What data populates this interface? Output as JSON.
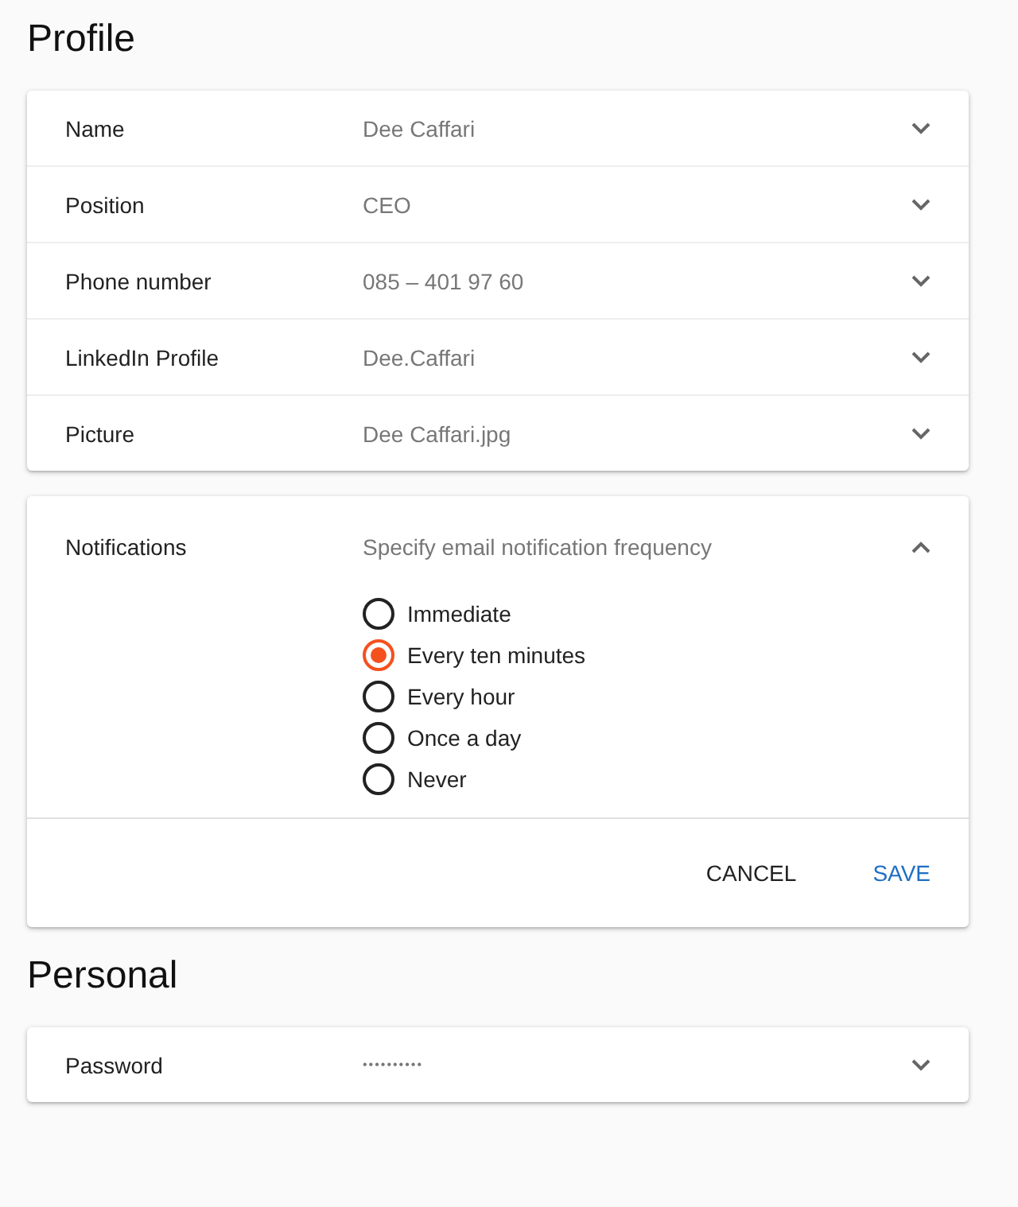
{
  "sections": [
    {
      "title": "Profile",
      "panels": [
        {
          "label": "Name",
          "value": "Dee Caffari",
          "expanded": false
        },
        {
          "label": "Position",
          "value": "CEO",
          "expanded": false
        },
        {
          "label": "Phone number",
          "value": "085 – 401 97 60",
          "expanded": false
        },
        {
          "label": "LinkedIn Profile",
          "value": "Dee.Caffari",
          "expanded": false
        },
        {
          "label": "Picture",
          "value": "Dee Caffari.jpg",
          "expanded": false
        }
      ]
    },
    {
      "panels": [
        {
          "label": "Notifications",
          "value": "Specify email notification frequency",
          "expanded": true,
          "options": [
            {
              "label": "Immediate",
              "selected": false
            },
            {
              "label": "Every ten minutes",
              "selected": true
            },
            {
              "label": "Every hour",
              "selected": false
            },
            {
              "label": "Once a day",
              "selected": false
            },
            {
              "label": "Never",
              "selected": false
            }
          ],
          "actions": [
            {
              "label": "CANCEL",
              "kind": "secondary"
            },
            {
              "label": "SAVE",
              "kind": "primary"
            }
          ]
        }
      ]
    },
    {
      "title": "Personal",
      "panels": [
        {
          "label": "Password",
          "value": "••••••••••",
          "expanded": false,
          "kind": "secret"
        }
      ]
    }
  ]
}
